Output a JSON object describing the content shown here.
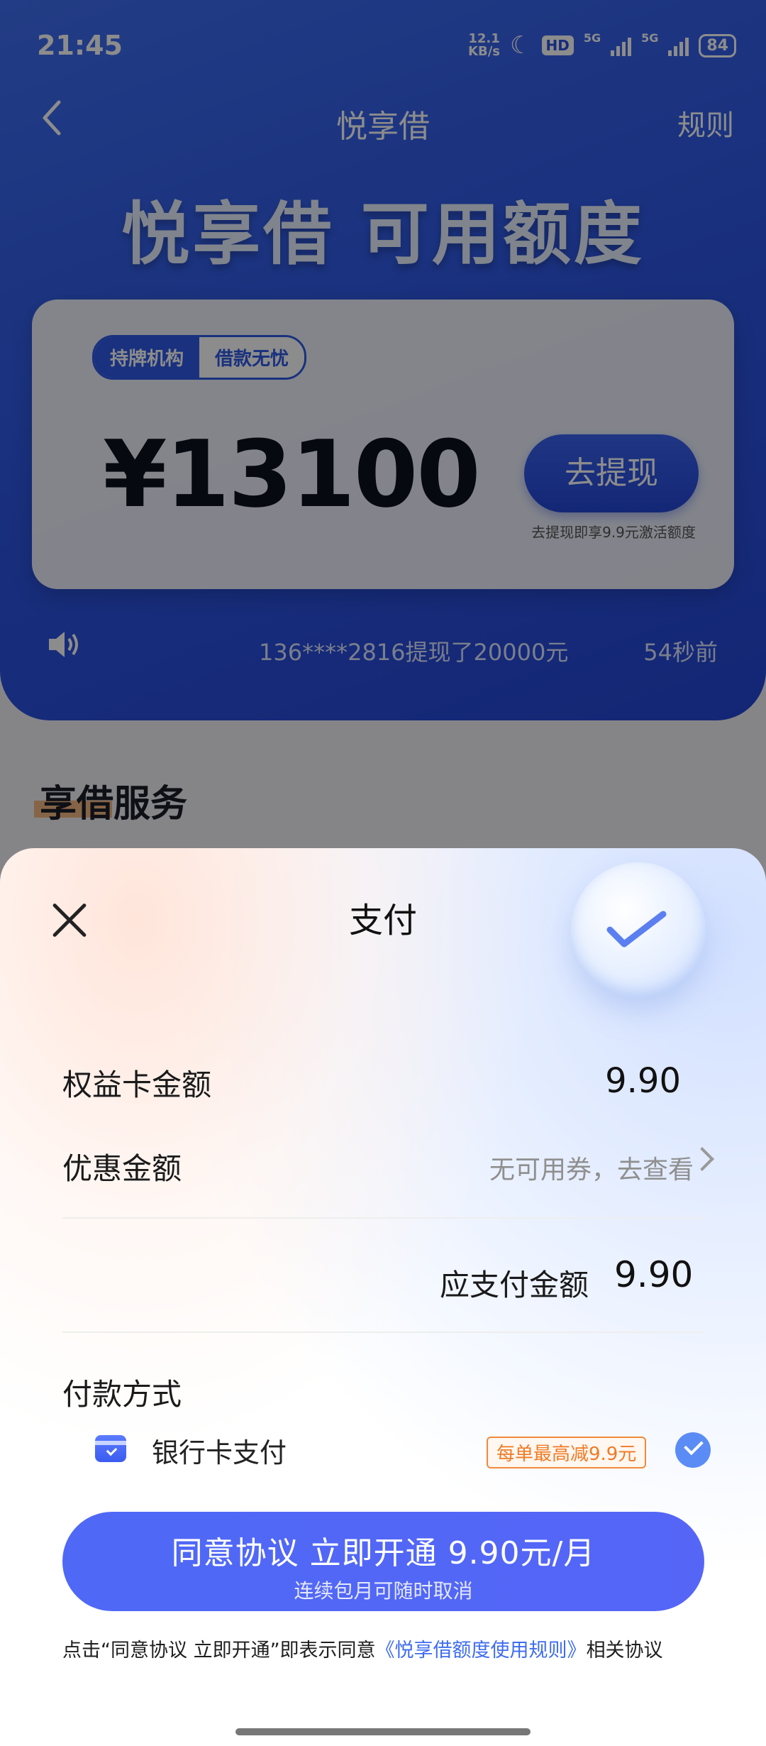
{
  "status_bar": {
    "time": "21:45",
    "net_speed_value": "12.1",
    "net_speed_unit": "KB/s",
    "hd_label": "HD",
    "network_1": "5G",
    "network_2": "5G",
    "battery": "84"
  },
  "nav": {
    "back_icon": "chevron-left-icon",
    "title": "悦享借",
    "rules_label": "规则"
  },
  "hero": {
    "title": "悦享借 可用额度",
    "pill_left": "持牌机构",
    "pill_right": "借款无忧",
    "credit_amount": "¥13100",
    "withdraw_label": "去提现",
    "withdraw_hint": "去提现即享9.9元激活额度"
  },
  "ticker": {
    "icon": "speaker-icon",
    "text": "136****2816提现了20000元",
    "time_ago": "54秒前"
  },
  "section": {
    "title": "享借服务"
  },
  "payment_sheet": {
    "title": "支付",
    "benefit_card_label": "权益卡金额",
    "benefit_card_value": "9.90",
    "discount_label": "优惠金额",
    "discount_link": "无可用券，去查看",
    "total_label": "应支付金额",
    "total_value": "9.90",
    "payment_method_title": "付款方式",
    "method_label": "银行卡支付",
    "method_promo": "每单最高减9.9元",
    "method_selected": true,
    "cta_main": "同意协议 立即开通 9.90元/月",
    "cta_sub": "连续包月可随时取消",
    "agreement_prefix": "点击“同意协议 立即开通”即表示同意",
    "agreement_link": "《悦享借额度使用规则》",
    "agreement_suffix": "相关协议"
  },
  "colors": {
    "brand_blue": "#2f59e6",
    "cta_blue": "#5066f6",
    "promo_orange": "#f07a24"
  }
}
